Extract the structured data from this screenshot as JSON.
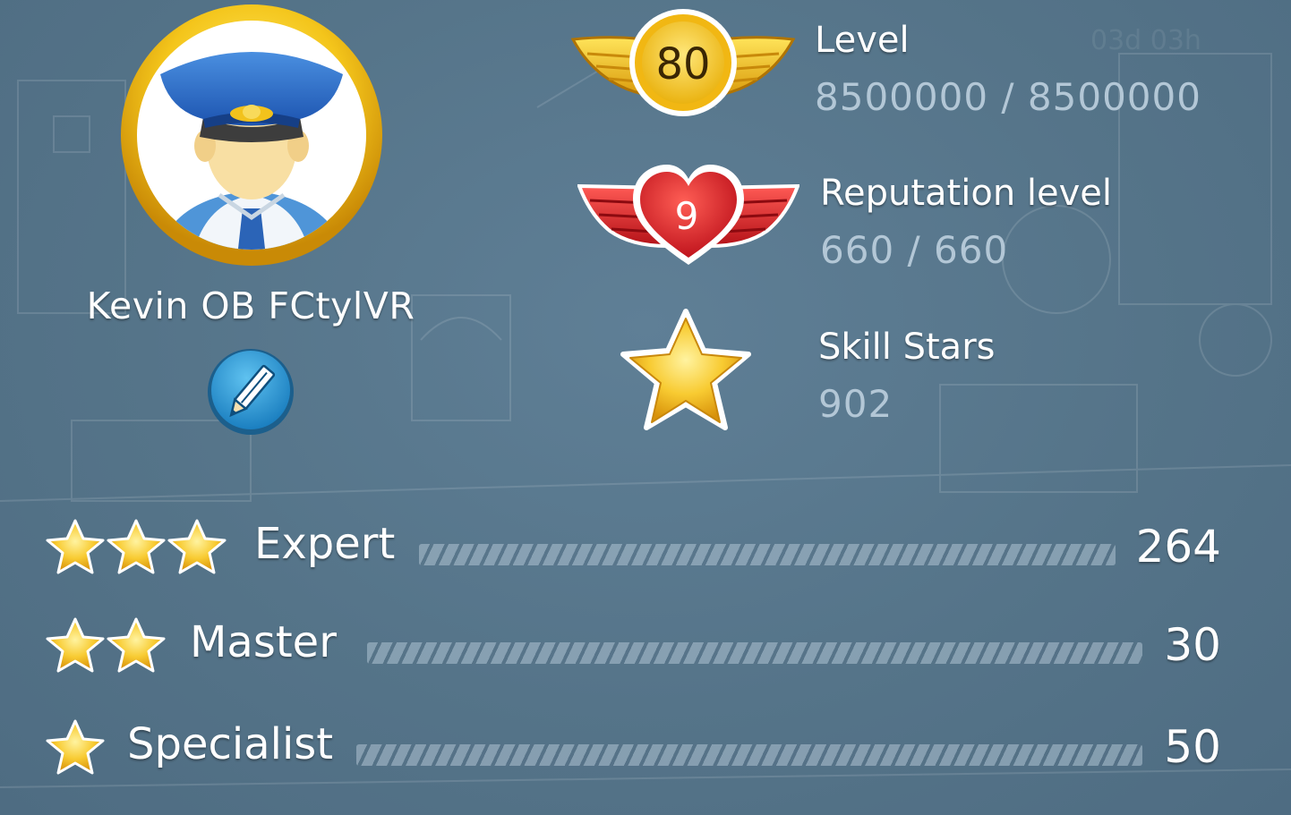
{
  "player": {
    "name": "Kevin OB FCtylVR",
    "avatar_icon": "pilot-avatar-icon",
    "edit_icon": "pencil-icon"
  },
  "stats": {
    "level": {
      "badge": "80",
      "label": "Level",
      "value": "8500000 / 8500000",
      "color": "#f3c319"
    },
    "reputation": {
      "badge": "9",
      "label": "Reputation level",
      "value": "660 / 660",
      "color": "#e0262c"
    },
    "skill_stars": {
      "label": "Skill Stars",
      "value": "902",
      "color": "#f6c21c"
    }
  },
  "ranks": [
    {
      "stars": 3,
      "label": "Expert",
      "count": "264"
    },
    {
      "stars": 2,
      "label": "Master",
      "count": "30"
    },
    {
      "stars": 1,
      "label": "Specialist",
      "count": "50"
    }
  ],
  "colors": {
    "background": "#587a90",
    "value_text": "#b3c7d6"
  }
}
